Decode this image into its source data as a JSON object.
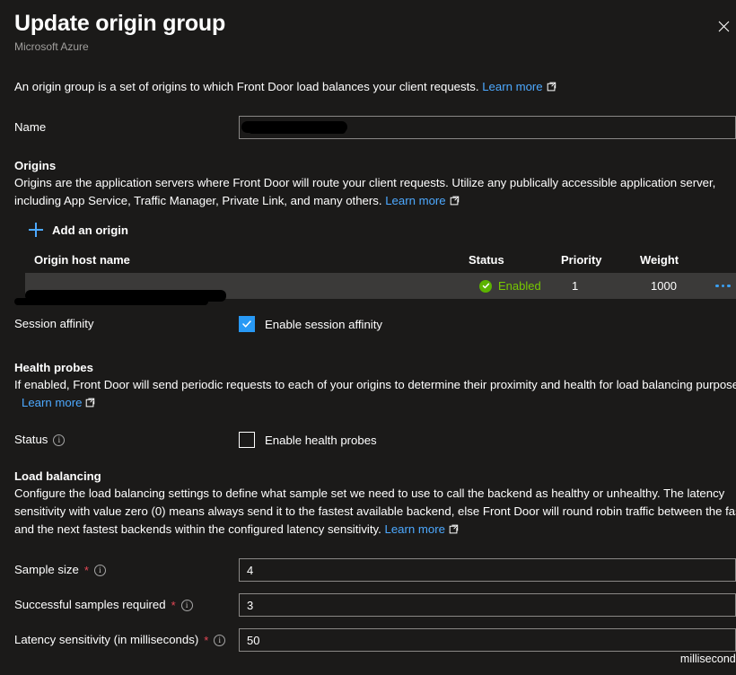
{
  "header": {
    "title": "Update origin group",
    "subtitle": "Microsoft Azure",
    "close_label": "Close",
    "close_icon": "close-icon"
  },
  "intro": {
    "text": "An origin group is a set of origins to which Front Door load balances your client requests.",
    "link_label": "Learn more",
    "link_icon": "external-link-icon"
  },
  "name_field": {
    "label": "Name",
    "value": "",
    "placeholder": "",
    "redacted": true
  },
  "origins": {
    "title": "Origins",
    "desc_line1": "Origins are the application servers where Front Door will route your client requests. Utilize any publically accessible application server,",
    "desc_line2": "including App Service, Traffic Manager, Private Link, and many others.",
    "link_label": "Learn more",
    "add_label": "Add an origin",
    "add_icon": "plus-icon",
    "columns": {
      "host": "Origin host name",
      "status": "Status",
      "priority": "Priority",
      "weight": "Weight"
    },
    "rows": [
      {
        "host": "",
        "host_redacted": true,
        "status": "Enabled",
        "status_icon": "check-circle-icon",
        "status_color": "#77c900",
        "priority": "1",
        "weight": "1000",
        "more_icon": "ellipsis-icon"
      }
    ]
  },
  "session_affinity": {
    "label": "Session affinity",
    "checkbox_label": "Enable session affinity",
    "checked": true
  },
  "health_probes": {
    "title": "Health probes",
    "desc": "If enabled, Front Door will send periodic requests to each of your origins to determine their proximity and health for load balancing purposes.",
    "link_label": "Learn more",
    "status_label": "Status",
    "status_info_icon": "info-icon",
    "checkbox_label": "Enable health probes",
    "checked": false
  },
  "load_balancing": {
    "title": "Load balancing",
    "desc_line1": "Configure the load balancing settings to define what sample set we need to use to call the backend as healthy or unhealthy. The latency",
    "desc_line2": "sensitivity with value zero (0) means always send it to the fastest available backend, else Front Door will round robin traffic between the fastest",
    "desc_line3": "and the next fastest backends within the configured latency sensitivity.",
    "link_label": "Learn more",
    "fields": [
      {
        "label": "Sample size",
        "required": "*",
        "info_icon": "info-icon",
        "value": "4"
      },
      {
        "label": "Successful samples required",
        "required": "*",
        "info_icon": "info-icon",
        "value": "3"
      },
      {
        "label": "Latency sensitivity (in milliseconds)",
        "required": "*",
        "info_icon": "info-icon",
        "value": "50"
      }
    ],
    "unit_suffix": "milliseconds"
  },
  "colors": {
    "background": "#1b1a19",
    "link": "#4da9ff",
    "accent": "#2899f5",
    "success": "#5cb300",
    "required": "#e74856",
    "row_bg": "#3b3a39"
  }
}
